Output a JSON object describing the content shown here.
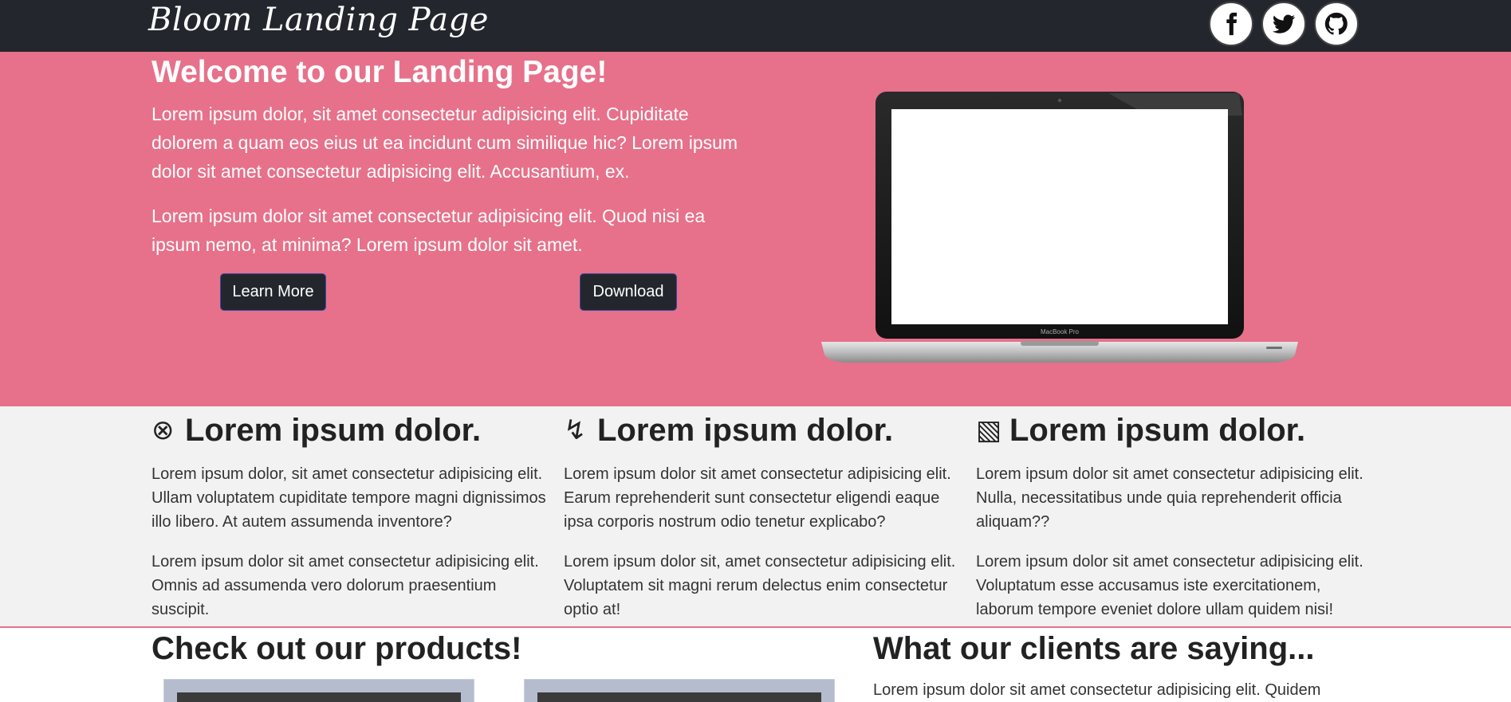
{
  "navbar": {
    "brand": "Bloom Landing Page",
    "social": [
      {
        "name": "facebook-icon"
      },
      {
        "name": "twitter-icon"
      },
      {
        "name": "github-icon"
      }
    ]
  },
  "hero": {
    "title": "Welcome to our Landing Page!",
    "paragraph1": "Lorem ipsum dolor, sit amet consectetur adipisicing elit. Cupiditate dolorem a quam eos eius ut ea incidunt cum similique hic? Lorem ipsum dolor sit amet consectetur adipisicing elit. Accusantium, ex.",
    "paragraph2": "Lorem ipsum dolor sit amet consectetur adipisicing elit. Quod nisi ea ipsum nemo, at minima? Lorem ipsum dolor sit amet.",
    "learn_more_label": "Learn More",
    "download_label": "Download",
    "laptop_caption": "MacBook Pro"
  },
  "features": [
    {
      "icon": "⊗",
      "icon_name": "circle-x-icon",
      "title": "Lorem ipsum dolor.",
      "p1": "Lorem ipsum dolor, sit amet consectetur adipisicing elit. Ullam voluptatem cupiditate tempore magni dignissimos illo libero. At autem assumenda inventore?",
      "p2": "Lorem ipsum dolor sit amet consectetur adipisicing elit. Omnis ad assumenda vero dolorum praesentium suscipit."
    },
    {
      "icon": "↯",
      "icon_name": "lightning-icon",
      "title": "Lorem ipsum dolor.",
      "p1": "Lorem ipsum dolor sit amet consectetur adipisicing elit. Earum reprehenderit sunt consectetur eligendi eaque ipsa corporis nostrum odio tenetur explicabo?",
      "p2": "Lorem ipsum dolor sit, amet consectetur adipisicing elit. Voluptatem sit magni rerum delectus enim consectetur optio at!"
    },
    {
      "icon": "▧",
      "icon_name": "hatched-square-icon",
      "title": "Lorem ipsum dolor.",
      "p1": "Lorem ipsum dolor sit amet consectetur adipisicing elit. Nulla, necessitatibus unde quia reprehenderit officia aliquam??",
      "p2": "Lorem ipsum dolor sit amet consectetur adipisicing elit. Voluptatum esse accusamus iste exercitationem, laborum tempore eveniet dolore ullam quidem nisi!"
    }
  ],
  "products": {
    "title": "Check out our products!"
  },
  "clients": {
    "title": "What our clients are saying...",
    "text": "Lorem ipsum dolor sit amet consectetur adipisicing elit. Quidem"
  },
  "colors": {
    "navbar_bg": "#23272d",
    "hero_bg": "#e7718a",
    "features_bg": "#f2f2f2"
  }
}
